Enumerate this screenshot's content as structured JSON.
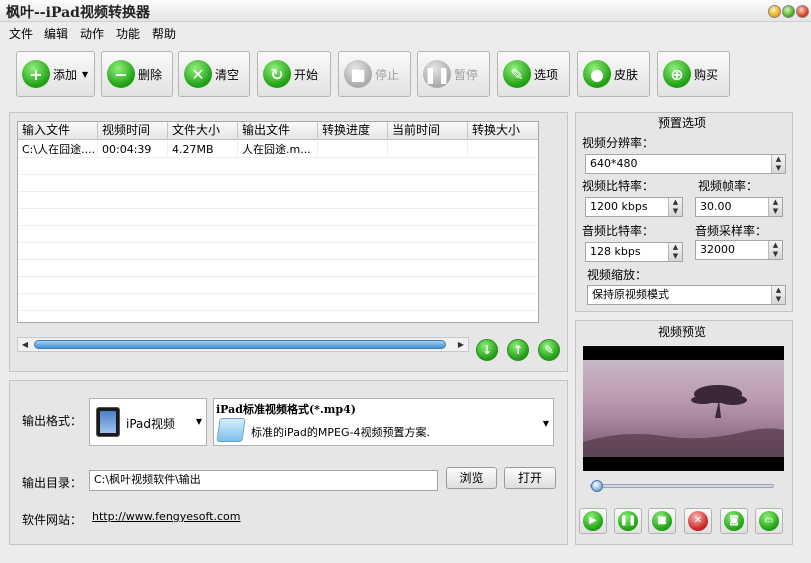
{
  "app": {
    "title": "枫叶--iPad视频转换器"
  },
  "menu": [
    "文件",
    "编辑",
    "动作",
    "功能",
    "帮助"
  ],
  "toolbar": {
    "add": "添加",
    "delete": "删除",
    "clear": "清空",
    "start": "开始",
    "stop": "停止",
    "pause": "暂停",
    "options": "选项",
    "skin": "皮肤",
    "buy": "购买"
  },
  "table": {
    "headers": [
      "输入文件",
      "视频时间",
      "文件大小",
      "输出文件",
      "转换进度",
      "当前时间",
      "转换大小"
    ],
    "rows": [
      [
        "C:\\人在囧途....",
        "00:04:39",
        "4.27MB",
        "人在囧途.m...",
        "",
        "",
        ""
      ]
    ]
  },
  "preset": {
    "title": "预置选项",
    "resolution_label": "视频分辨率：",
    "resolution": "640*480",
    "video_bitrate_label": "视频比特率：",
    "video_bitrate": "1200 kbps",
    "framerate_label": "视频帧率：",
    "framerate": "30.00",
    "audio_bitrate_label": "音频比特率：",
    "audio_bitrate": "128 kbps",
    "samplerate_label": "音频采样率：",
    "samplerate": "32000",
    "scale_label": "视频缩放：",
    "scale": "保持原视频模式"
  },
  "preview": {
    "title": "视频预览"
  },
  "output": {
    "format_label": "输出格式：",
    "device": "iPad视频",
    "format_title": "iPad标准视频格式(*.mp4)",
    "format_desc": "标准的iPad的MPEG-4视频预置方案.",
    "dir_label": "输出目录：",
    "dir": "C:\\枫叶视频软件\\输出",
    "browse": "浏览",
    "open": "打开",
    "site_label": "软件网站：",
    "site": "http://www.fengyesoft.com"
  },
  "colors": {
    "accent_green": "#1e9e12",
    "scroll_blue": "#3f8fd2"
  }
}
